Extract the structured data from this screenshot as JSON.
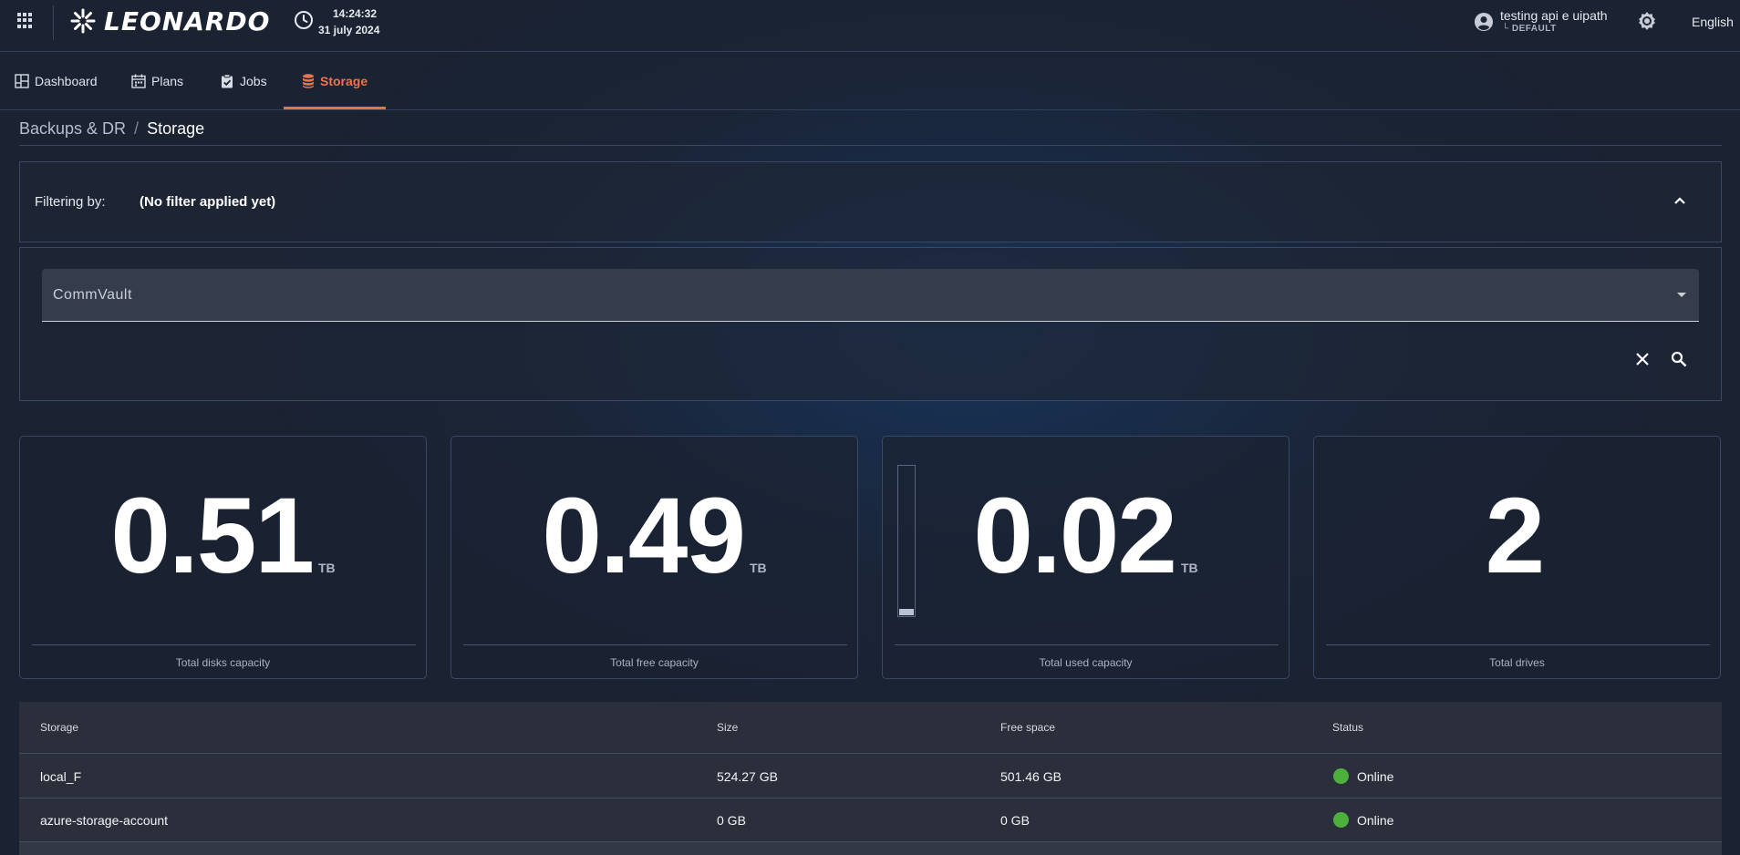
{
  "header": {
    "brand": "LEONARDO",
    "time": "14:24:32",
    "date": "31 july 2024",
    "user_name": "testing api e uipath",
    "user_tenant": "└ DEFAULT",
    "language": "English"
  },
  "nav": {
    "tabs": [
      {
        "label": "Dashboard",
        "icon": "dashboard-icon"
      },
      {
        "label": "Plans",
        "icon": "calendar-icon"
      },
      {
        "label": "Jobs",
        "icon": "clipboard-check-icon"
      },
      {
        "label": "Storage",
        "icon": "database-icon",
        "active": true
      }
    ]
  },
  "breadcrumb": {
    "parent": "Backups & DR",
    "separator": "/",
    "current": "Storage"
  },
  "filter": {
    "label": "Filtering by:",
    "value": "(No filter applied yet)",
    "selected_source": "CommVault"
  },
  "stats": [
    {
      "value": "0.51",
      "unit": "TB",
      "label": "Total disks capacity"
    },
    {
      "value": "0.49",
      "unit": "TB",
      "label": "Total free capacity"
    },
    {
      "value": "0.02",
      "unit": "TB",
      "label": "Total used capacity",
      "used_fraction": 0.04
    },
    {
      "value": "2",
      "unit": "",
      "label": "Total drives"
    }
  ],
  "table": {
    "columns": [
      "Storage",
      "Size",
      "Free space",
      "Status"
    ],
    "rows": [
      {
        "storage": "local_F",
        "size": "524.27 GB",
        "free": "501.46 GB",
        "status": "Online"
      },
      {
        "storage": "azure-storage-account",
        "size": "0 GB",
        "free": "0 GB",
        "status": "Online"
      }
    ]
  },
  "colors": {
    "accent": "#ef6e47",
    "status_online": "#4caf3e"
  }
}
